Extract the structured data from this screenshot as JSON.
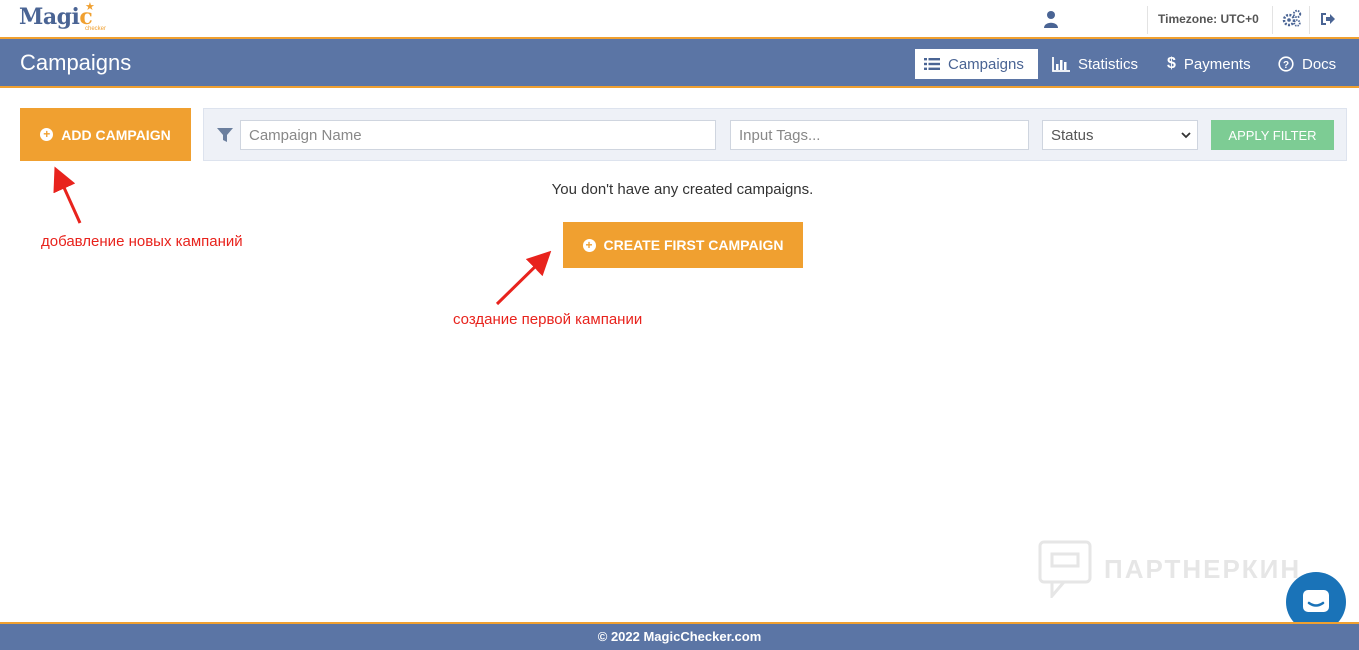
{
  "brand": {
    "logo_main": "Magic",
    "logo_sub": "checker"
  },
  "topbar": {
    "timezone": "Timezone: UTC+0"
  },
  "header": {
    "title": "Campaigns",
    "nav": [
      {
        "label": "Campaigns",
        "icon": "list-icon",
        "active": true
      },
      {
        "label": "Statistics",
        "icon": "bar-chart-icon",
        "active": false
      },
      {
        "label": "Payments",
        "icon": "dollar-icon",
        "active": false
      },
      {
        "label": "Docs",
        "icon": "question-circle-icon",
        "active": false
      }
    ]
  },
  "toolbar": {
    "add_label": "ADD CAMPAIGN",
    "name_placeholder": "Campaign Name",
    "tags_placeholder": "Input Tags...",
    "status_value": "Status",
    "apply_label": "APPLY FILTER"
  },
  "main": {
    "empty_message": "You don't have any created campaigns.",
    "create_label": "CREATE FIRST CAMPAIGN"
  },
  "annotations": {
    "add_note": "добавление новых кампаний",
    "create_note": "создание первой кампании"
  },
  "watermark": {
    "text": "ПАРТНЕРКИН"
  },
  "footer": {
    "copyright": "© 2022 MagicChecker.com"
  },
  "colors": {
    "accent": "#f0a030",
    "nav": "#5b75a5",
    "apply": "#7dcc94",
    "annotation": "#e8231d"
  }
}
